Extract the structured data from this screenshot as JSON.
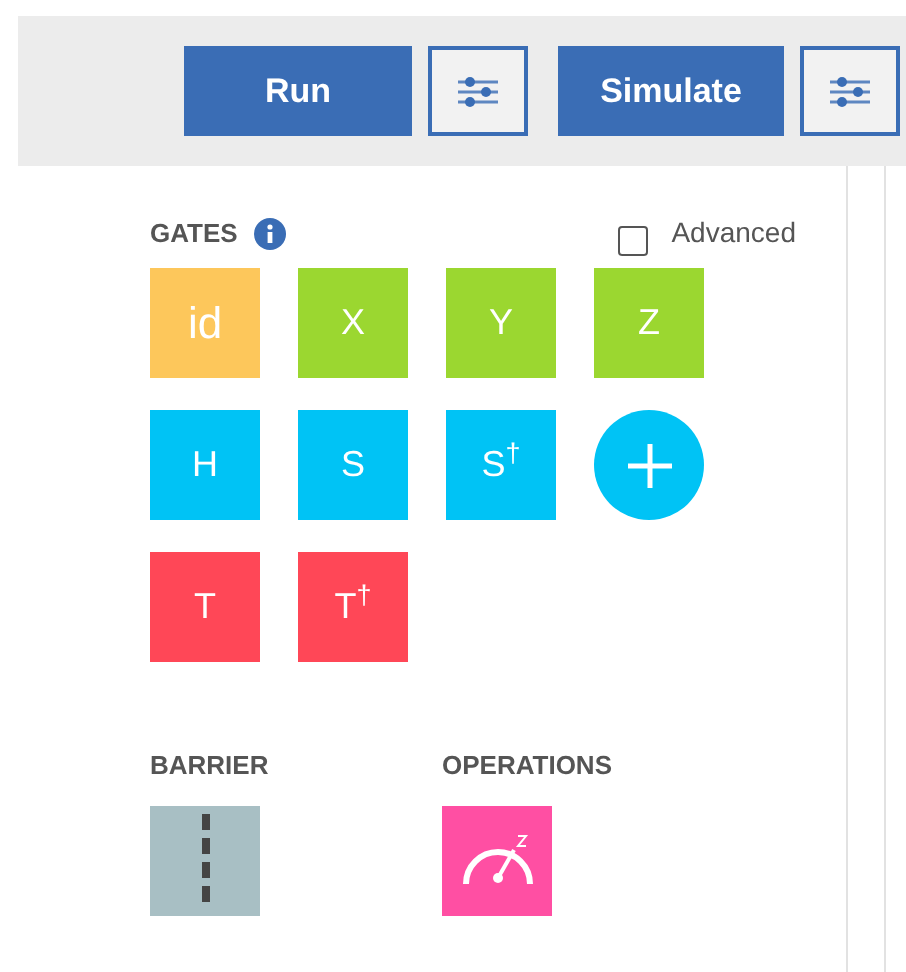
{
  "toolbar": [
    {
      "kind": "action",
      "label": "Run"
    },
    {
      "kind": "settings"
    },
    {
      "kind": "action",
      "label": "Simulate"
    },
    {
      "kind": "settings"
    }
  ],
  "gates_section": {
    "title": "GATES",
    "advanced": {
      "label": "Advanced",
      "checked": false
    },
    "gates": [
      {
        "kind": "gate",
        "label": "id",
        "color": "#fdc75b"
      },
      {
        "kind": "gate",
        "label": "X",
        "color": "#9bd730"
      },
      {
        "kind": "gate",
        "label": "Y",
        "color": "#9bd730"
      },
      {
        "kind": "gate",
        "label": "Z",
        "color": "#9bd730"
      },
      {
        "kind": "gate",
        "label": "H",
        "color": "#00c3f5"
      },
      {
        "kind": "gate",
        "label": "S",
        "color": "#00c3f5"
      },
      {
        "kind": "gate",
        "label": "S$^{†}$",
        "color": "#00c3f5"
      },
      {
        "kind": "add",
        "color": "#00c3f5"
      },
      {
        "kind": "gate",
        "label": "T",
        "color": "#ff4757"
      },
      {
        "kind": "gate",
        "label": "T$^{†}$",
        "color": "#ff4757"
      }
    ]
  },
  "barrier_section": {
    "title": "BARRIER"
  },
  "operations_section": {
    "title": "OPERATIONS"
  }
}
